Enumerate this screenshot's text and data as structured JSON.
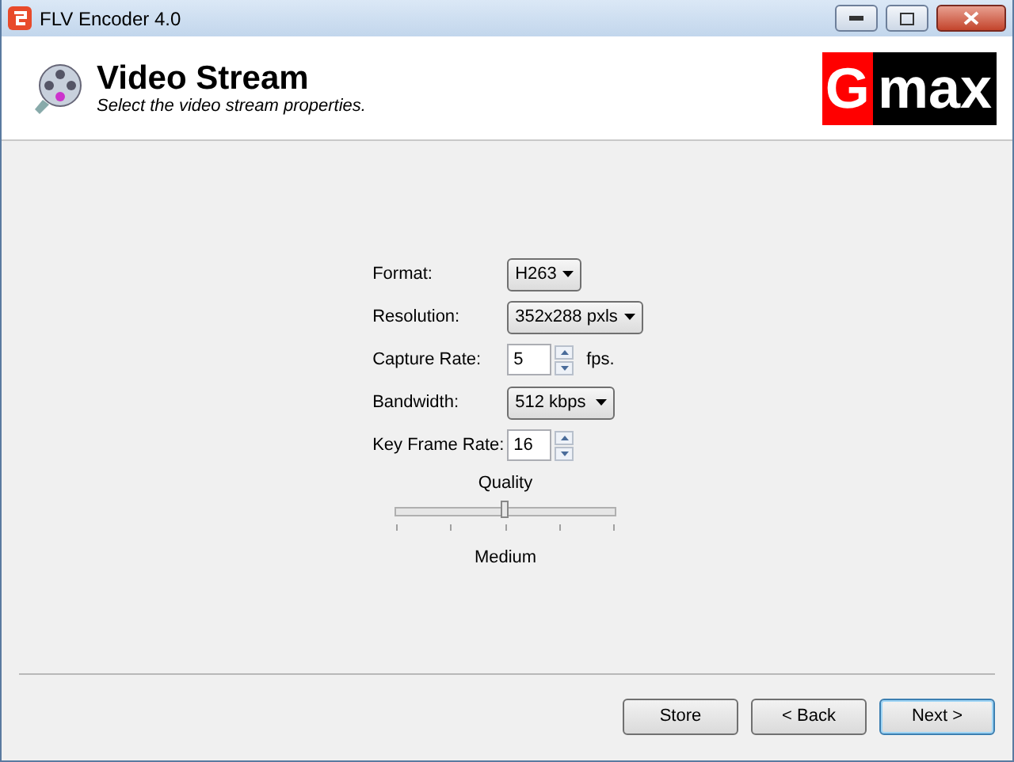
{
  "window": {
    "title": "FLV Encoder 4.0"
  },
  "header": {
    "title": "Video Stream",
    "subtitle": "Select the video stream properties.",
    "logo_first": "G",
    "logo_rest": "max"
  },
  "fields": [
    {
      "label": "Format:",
      "kind": "dropdown",
      "value": "H263"
    },
    {
      "label": "Resolution:",
      "kind": "dropdown",
      "value": "352x288 pxls"
    },
    {
      "label": "Capture Rate:",
      "kind": "spinner",
      "value": "5",
      "unit": "fps."
    },
    {
      "label": "Bandwidth:",
      "kind": "dropdown",
      "value": "512 kbps"
    },
    {
      "label": "Key Frame Rate:",
      "kind": "spinner",
      "value": "16"
    }
  ],
  "quality": {
    "label": "Quality",
    "level": 0.5,
    "reading": "Medium"
  },
  "buttons": [
    {
      "label": "Store",
      "focused": false
    },
    {
      "label": "< Back",
      "focused": false
    },
    {
      "label": "Next >",
      "focused": true
    }
  ]
}
